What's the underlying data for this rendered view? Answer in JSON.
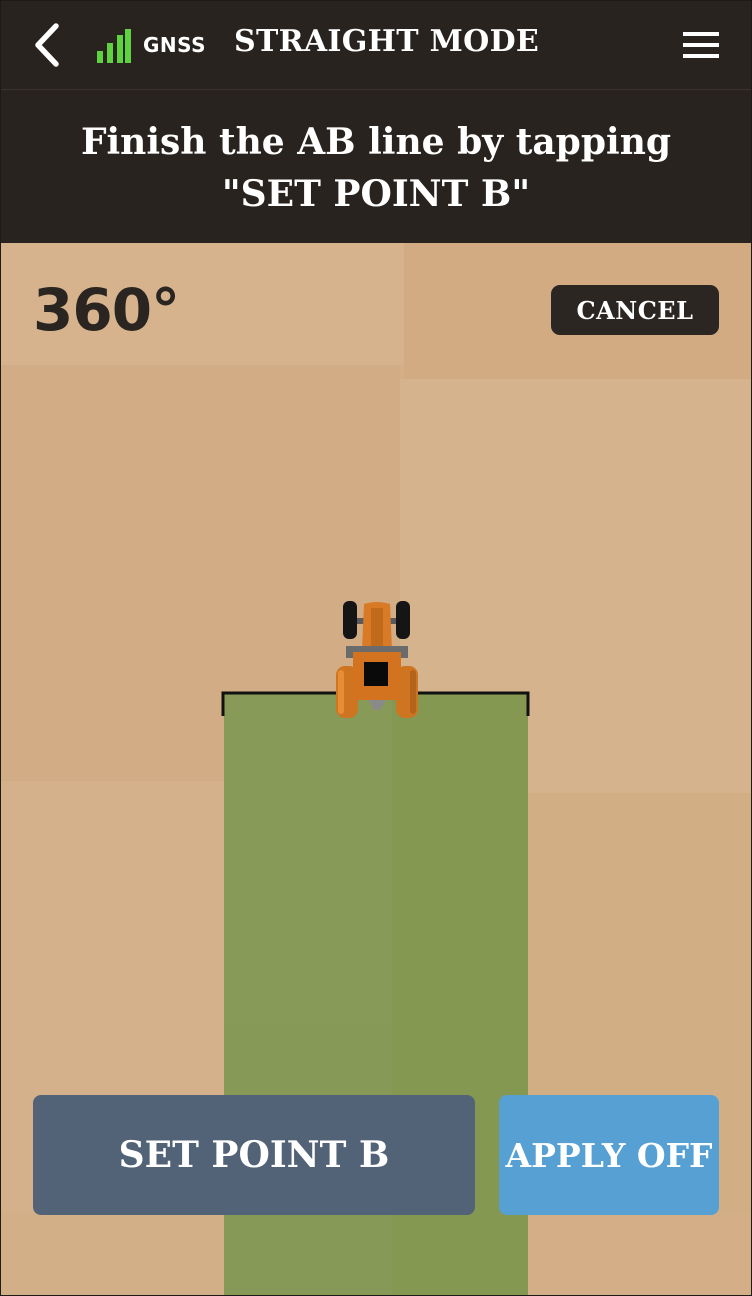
{
  "header": {
    "gnss_label": "GNSS",
    "title": "STRAIGHT MODE",
    "back_icon": "chevron-left-icon",
    "signal_icon": "signal-bars-icon",
    "menu_icon": "hamburger-menu-icon"
  },
  "instruction": {
    "line1": "Finish the AB line by tapping",
    "line2": "\"SET POINT B\""
  },
  "map": {
    "heading": "360°",
    "cancel_label": "CANCEL"
  },
  "actions": {
    "set_point_b_label": "SET POINT B",
    "apply_label": "APPLY OFF"
  },
  "colors": {
    "header_bg": "#28231e",
    "field_soil": "#d3ae86",
    "coverage_green": "#879a56",
    "signal_green": "#5fd23f",
    "set_point_button": "#526378",
    "apply_button": "#56a0d3",
    "tractor_orange": "#d87a26"
  }
}
